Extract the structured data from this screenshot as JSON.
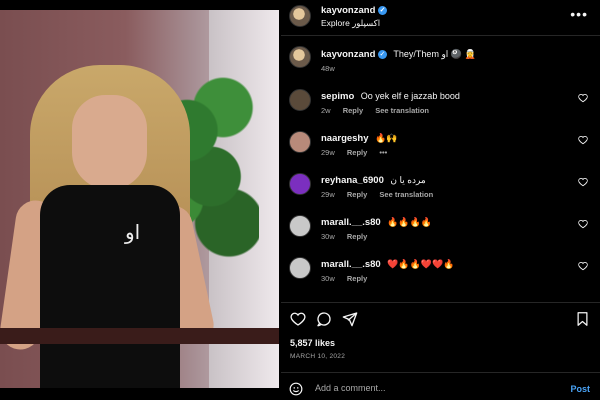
{
  "post": {
    "username": "kayvonzand",
    "subtitle": "Explore اکسپلور",
    "shirt_text": "او",
    "caption": {
      "username": "kayvonzand",
      "text": "They/Them او 🎱 🧝",
      "time": "48w"
    },
    "comments": [
      {
        "username": "sepimo",
        "text": "Oo yek elf e jazzab bood",
        "time": "2w",
        "reply": "Reply",
        "translation": "See translation",
        "avatar_color": "#5a4a3a"
      },
      {
        "username": "naargeshy",
        "text": "🔥🙌",
        "time": "29w",
        "reply": "Reply",
        "more": "•••",
        "avatar_color": "#b88a7a"
      },
      {
        "username": "reyhana_6900",
        "text": "مرده یا ن",
        "time": "29w",
        "reply": "Reply",
        "translation": "See translation",
        "avatar_color": "#7b2fbf"
      },
      {
        "username": "marall.__.s80",
        "text": "🔥🔥🔥🔥",
        "time": "30w",
        "reply": "Reply",
        "avatar_color": "#c8c8c8"
      },
      {
        "username": "marall.__.s80",
        "text": "❤️🔥🔥❤️❤️🔥",
        "time": "30w",
        "reply": "Reply",
        "avatar_color": "#c8c8c8"
      }
    ],
    "likes": "5,857 likes",
    "date": "MARCH 10, 2022",
    "add_comment_placeholder": "Add a comment...",
    "post_label": "Post"
  },
  "icons": {
    "more": "more-options-icon",
    "verified": "verified-badge-icon",
    "heart": "heart-icon",
    "comment": "comment-icon",
    "share": "share-icon",
    "save": "bookmark-icon",
    "emoji": "emoji-icon"
  },
  "colors": {
    "background": "#000000",
    "muted_text": "#a8a8a8",
    "verified": "#3897f0",
    "post_link": "#4aa3f5"
  }
}
